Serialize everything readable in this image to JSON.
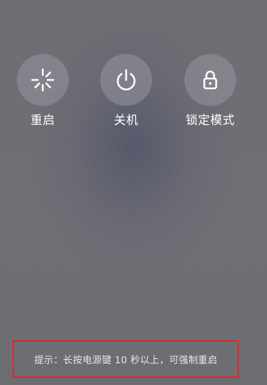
{
  "actions": [
    {
      "label": "重启",
      "icon": "restart-spinner-icon"
    },
    {
      "label": "关机",
      "icon": "power-icon"
    },
    {
      "label": "锁定模式",
      "icon": "lock-icon"
    }
  ],
  "hint": {
    "text": "提示：长按电源键 10 秒以上，可强制重启",
    "highlight_color": "#e0262b"
  },
  "colors": {
    "background": "#6e6f74",
    "button_fill": "#9a9aa2",
    "text": "#ffffff"
  }
}
